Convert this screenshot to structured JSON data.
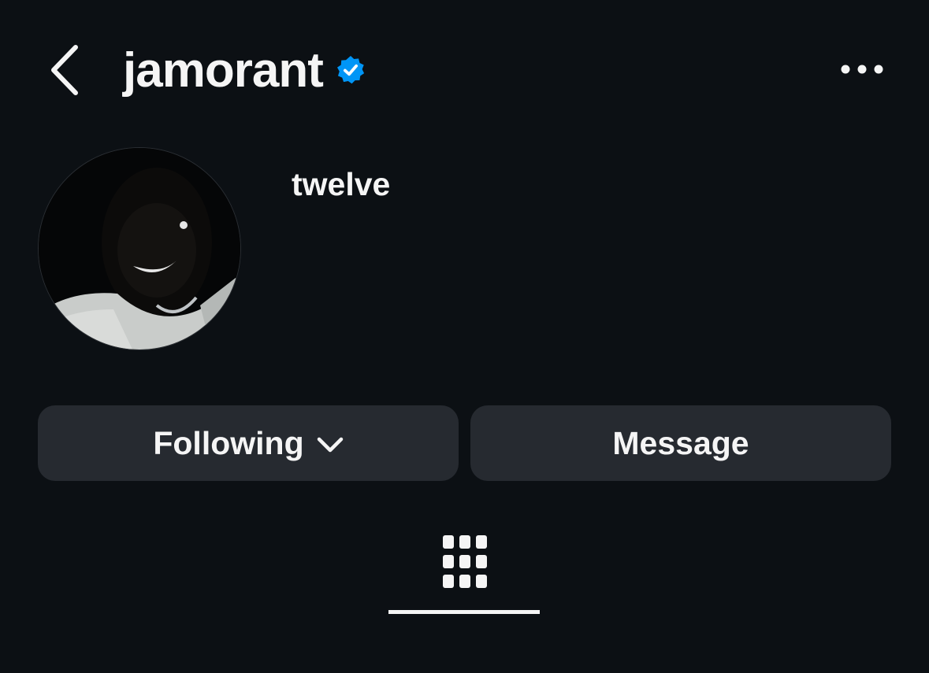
{
  "header": {
    "username": "jamorant",
    "back_icon": "chevron-left-icon",
    "verified_icon": "verified-badge-icon",
    "more_icon": "ellipsis-icon"
  },
  "profile": {
    "full_name": "twelve",
    "avatar_icon": "profile-photo"
  },
  "actions": {
    "following_label": "Following",
    "following_icon": "chevron-down-icon",
    "message_label": "Message"
  },
  "tabs": {
    "grid_icon": "grid-icon"
  },
  "colors": {
    "background": "#0c1014",
    "button": "#262a30",
    "text": "#f5f5f5",
    "verified": "#0095f6"
  }
}
